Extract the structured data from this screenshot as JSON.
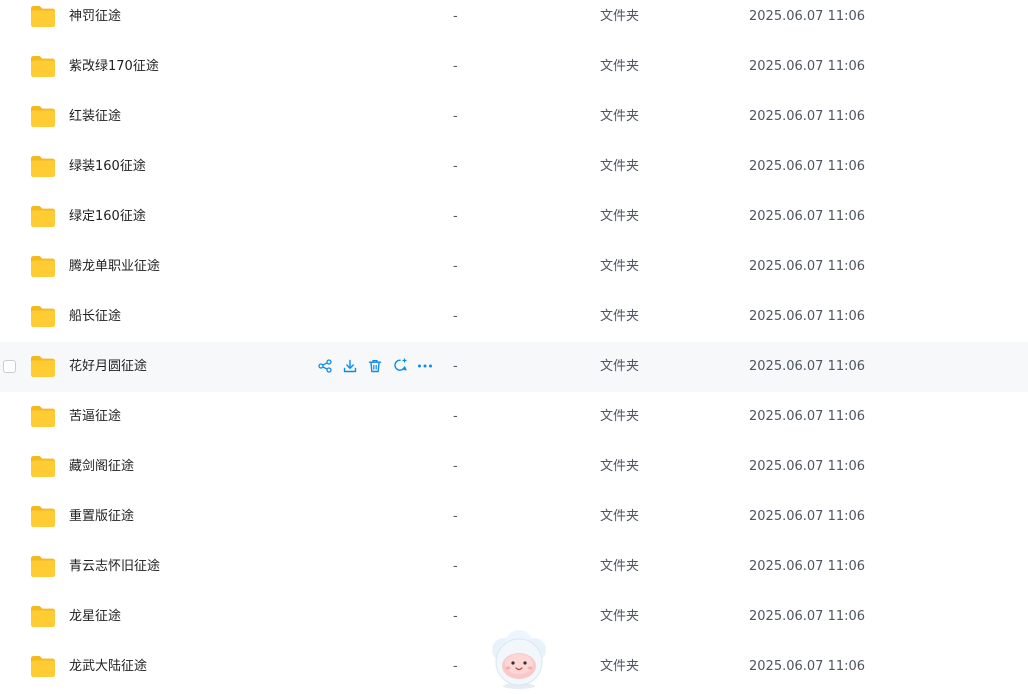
{
  "columns": {
    "size_placeholder": "-",
    "type_label": "文件夹"
  },
  "files": [
    {
      "name": "神罚征途",
      "size": "-",
      "type": "文件夹",
      "modified": "2025.06.07 11:06"
    },
    {
      "name": "紫改绿170征途",
      "size": "-",
      "type": "文件夹",
      "modified": "2025.06.07 11:06"
    },
    {
      "name": "红装征途",
      "size": "-",
      "type": "文件夹",
      "modified": "2025.06.07 11:06"
    },
    {
      "name": "绿装160征途",
      "size": "-",
      "type": "文件夹",
      "modified": "2025.06.07 11:06"
    },
    {
      "name": "绿定160征途",
      "size": "-",
      "type": "文件夹",
      "modified": "2025.06.07 11:06"
    },
    {
      "name": "腾龙单职业征途",
      "size": "-",
      "type": "文件夹",
      "modified": "2025.06.07 11:06"
    },
    {
      "name": "船长征途",
      "size": "-",
      "type": "文件夹",
      "modified": "2025.06.07 11:06"
    },
    {
      "name": "花好月圆征途",
      "size": "-",
      "type": "文件夹",
      "modified": "2025.06.07 11:06",
      "hovered": true
    },
    {
      "name": "苦逼征途",
      "size": "-",
      "type": "文件夹",
      "modified": "2025.06.07 11:06"
    },
    {
      "name": "藏剑阁征途",
      "size": "-",
      "type": "文件夹",
      "modified": "2025.06.07 11:06"
    },
    {
      "name": "重置版征途",
      "size": "-",
      "type": "文件夹",
      "modified": "2025.06.07 11:06"
    },
    {
      "name": "青云志怀旧征途",
      "size": "-",
      "type": "文件夹",
      "modified": "2025.06.07 11:06"
    },
    {
      "name": "龙星征途",
      "size": "-",
      "type": "文件夹",
      "modified": "2025.06.07 11:06"
    },
    {
      "name": "龙武大陆征途",
      "size": "-",
      "type": "文件夹",
      "modified": "2025.06.07 11:06"
    }
  ],
  "hover_actions": [
    {
      "icon": "share-icon"
    },
    {
      "icon": "download-icon"
    },
    {
      "icon": "trash-icon"
    },
    {
      "icon": "ai-chat-icon"
    },
    {
      "icon": "more-icon"
    }
  ],
  "colors": {
    "folder": "#FFCC33",
    "folder_tab": "#F5B81E",
    "action_icon": "#0C8CE9",
    "hover_row": "#F7F8FA",
    "text_primary": "#1F1F1F",
    "text_secondary": "#4E5561"
  }
}
